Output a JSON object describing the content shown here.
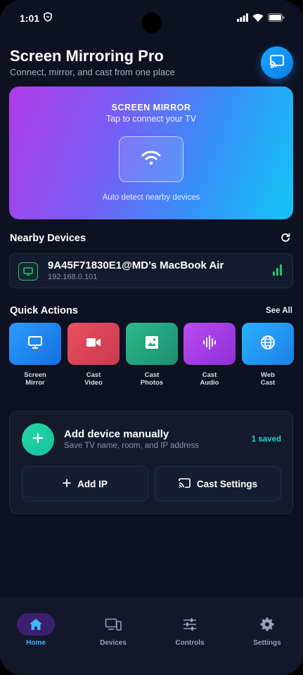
{
  "status_bar": {
    "time": "1:01"
  },
  "header": {
    "title": "Screen Mirroring Pro",
    "subtitle": "Connect, mirror, and cast from one place"
  },
  "hero": {
    "title": "SCREEN MIRROR",
    "subtitle": "Tap to connect your TV",
    "note": "Auto detect nearby devices"
  },
  "nearby": {
    "title": "Nearby Devices",
    "devices": [
      {
        "name": "9A45F71830E1@MD’s MacBook Air",
        "ip": "192.168.0.101"
      }
    ]
  },
  "quick_actions": {
    "title": "Quick Actions",
    "see_all": "See All",
    "items": [
      {
        "label": "Screen\nMirror",
        "icon": "monitor-icon",
        "color": "#1e8cf5"
      },
      {
        "label": "Cast\nVideo",
        "icon": "video-camera-icon",
        "color": "#e0495c"
      },
      {
        "label": "Cast\nPhotos",
        "icon": "image-icon",
        "color": "#23a882"
      },
      {
        "label": "Cast\nAudio",
        "icon": "audio-wave-icon",
        "color": "#a63de6"
      },
      {
        "label": "Web\nCast",
        "icon": "globe-icon",
        "color": "#1e9af5"
      }
    ]
  },
  "add_device": {
    "title": "Add device manually",
    "subtitle": "Save TV name, room, and IP address",
    "saved_badge": "1 saved",
    "add_ip_label": "Add IP",
    "cast_settings_label": "Cast Settings"
  },
  "bottom_nav": {
    "items": [
      {
        "label": "Home",
        "icon": "home-icon",
        "active": true
      },
      {
        "label": "Devices",
        "icon": "devices-icon",
        "active": false
      },
      {
        "label": "Controls",
        "icon": "sliders-icon",
        "active": false
      },
      {
        "label": "Settings",
        "icon": "gear-icon",
        "active": false
      }
    ]
  },
  "colors": {
    "background": "#0d1122",
    "accent": "#3fb6ff",
    "success": "#27c26a",
    "teal": "#22d1c7"
  }
}
